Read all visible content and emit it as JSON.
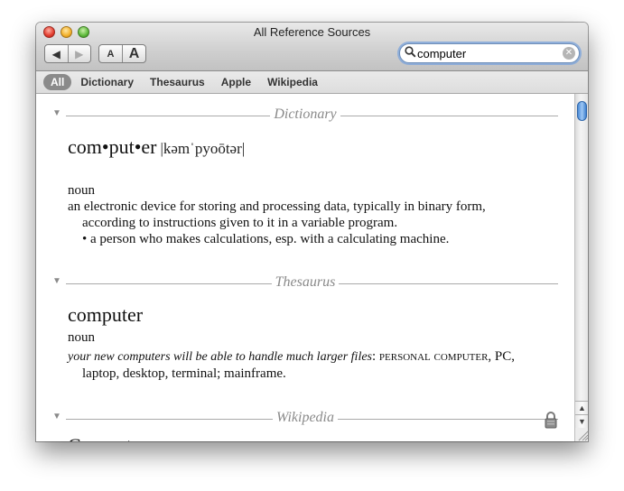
{
  "window": {
    "title": "All Reference Sources"
  },
  "toolbar": {
    "back_icon": "◀",
    "forward_icon": "▶",
    "font_smaller_label": "A",
    "font_larger_label": "A"
  },
  "search": {
    "value": "computer",
    "clear_icon": "⊗"
  },
  "tabs": [
    {
      "label": "All",
      "active": true
    },
    {
      "label": "Dictionary"
    },
    {
      "label": "Thesaurus"
    },
    {
      "label": "Apple"
    },
    {
      "label": "Wikipedia"
    }
  ],
  "dictionary": {
    "section": "Dictionary",
    "headword": "com•put•er",
    "pronunciation": "|kəmˈpyoōtər|",
    "pos": "noun",
    "def1_line1": "an electronic device for storing and processing data, typically in binary form,",
    "def1_line2": "according to instructions given to it in a variable program.",
    "def2": "• a person who makes calculations, esp. with a calculating machine."
  },
  "thesaurus": {
    "section": "Thesaurus",
    "headword": "computer",
    "pos": "noun",
    "example": "your new computers will be able to handle much larger files",
    "syn_sc": "personal computer",
    "syn_rest": ", PC,",
    "syn_line2": "laptop, desktop, terminal; mainframe."
  },
  "wikipedia": {
    "section": "Wikipedia",
    "headword": "Computer"
  },
  "colors": {
    "accent": "#4a8ad6",
    "section_gray": "#8a8a8a"
  }
}
